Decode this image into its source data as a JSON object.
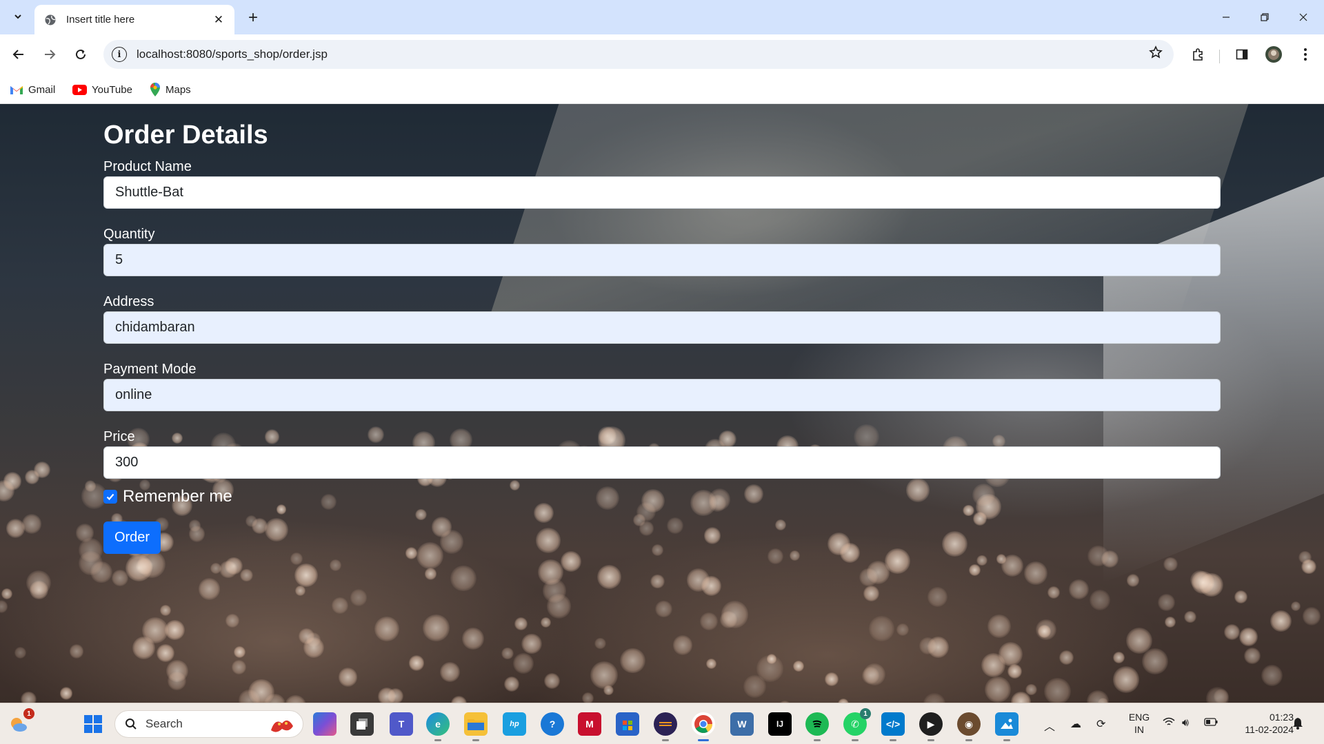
{
  "browser": {
    "tab_title": "Insert title here",
    "url": "localhost:8080/sports_shop/order.jsp",
    "bookmarks": [
      {
        "label": "Gmail",
        "icon": "gmail-icon"
      },
      {
        "label": "YouTube",
        "icon": "youtube-icon"
      },
      {
        "label": "Maps",
        "icon": "maps-icon"
      }
    ]
  },
  "form": {
    "heading": "Order Details",
    "fields": [
      {
        "label": "Product Name",
        "value": "Shuttle-Bat"
      },
      {
        "label": "Quantity",
        "value": "5"
      },
      {
        "label": "Address",
        "value": "chidambaran"
      },
      {
        "label": "Payment Mode",
        "value": "online"
      },
      {
        "label": "Price",
        "value": "300"
      }
    ],
    "remember_label": "Remember me",
    "remember_checked": true,
    "submit_label": "Order"
  },
  "taskbar": {
    "search_placeholder": "Search",
    "notification_count": "1",
    "whatsapp_badge": "1",
    "language": "ENG",
    "region": "IN",
    "time": "01:23",
    "date": "11-02-2024"
  },
  "colors": {
    "primary_button": "#0d6efd",
    "tabstrip": "#d3e3fd",
    "autofill": "#e8f0fe"
  }
}
